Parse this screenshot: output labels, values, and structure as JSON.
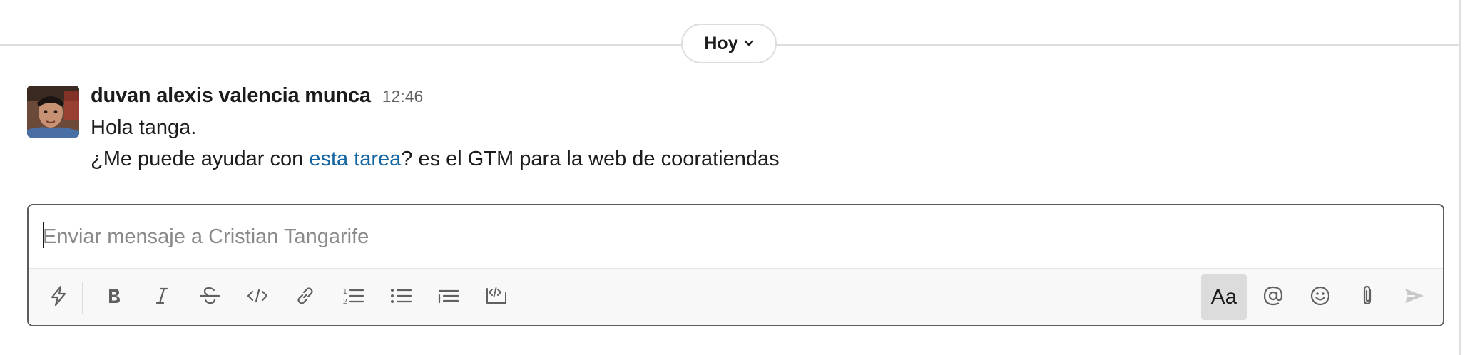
{
  "date_divider": {
    "label": "Hoy",
    "icon": "chevron-down-icon"
  },
  "message": {
    "author": "duvan alexis valencia munca",
    "time": "12:46",
    "line1": "Hola tanga.",
    "line2_before": "¿Me puede ayudar con ",
    "line2_link": "esta tarea",
    "line2_after": "? es el GTM para la web de cooratiendas"
  },
  "composer": {
    "placeholder": "Enviar mensaje a Cristian Tangarife",
    "value": "",
    "toolbar_left": [
      {
        "icon": "lightning-icon"
      },
      {
        "icon": "bold-icon"
      },
      {
        "icon": "italic-icon"
      },
      {
        "icon": "strikethrough-icon"
      },
      {
        "icon": "code-icon"
      },
      {
        "icon": "link-icon"
      },
      {
        "icon": "ordered-list-icon"
      },
      {
        "icon": "bulleted-list-icon"
      },
      {
        "icon": "blockquote-icon"
      },
      {
        "icon": "code-block-icon"
      }
    ],
    "format_toggle_label": "Aa",
    "toolbar_right": [
      {
        "icon": "mention-icon"
      },
      {
        "icon": "emoji-icon"
      },
      {
        "icon": "attachment-icon"
      },
      {
        "icon": "send-icon"
      }
    ]
  },
  "colors": {
    "link": "#1264a3",
    "text": "#1d1c1d",
    "muted": "#616061",
    "placeholder": "#8a8a8a",
    "toolbar_bg": "#f8f8f8"
  }
}
